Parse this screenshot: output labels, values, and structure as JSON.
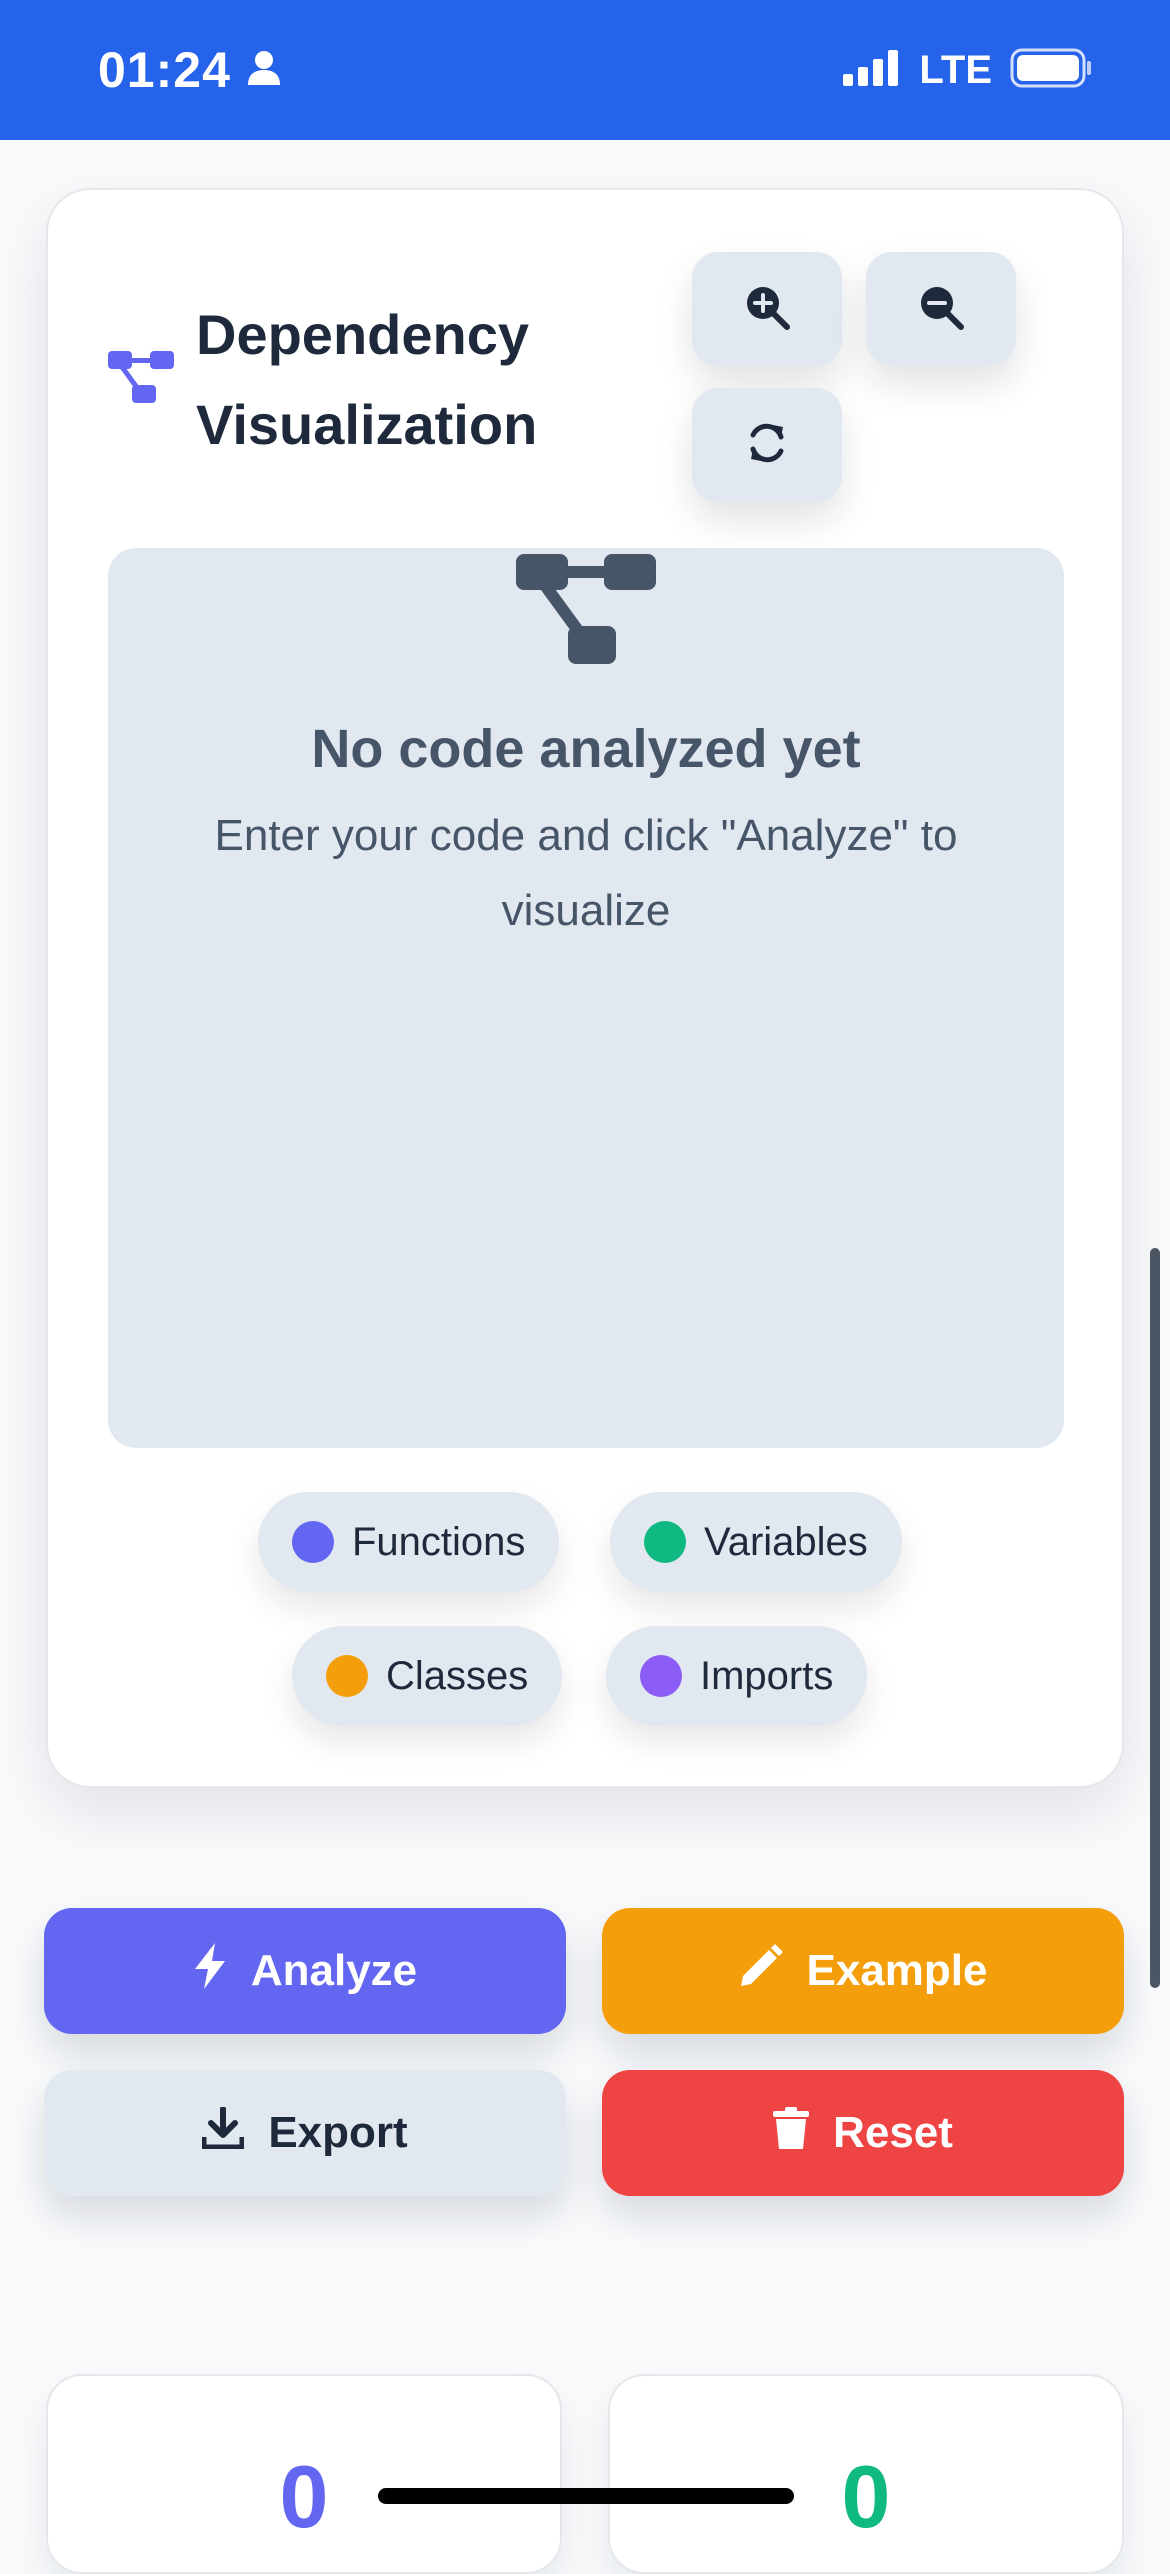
{
  "status_bar": {
    "time": "01:24",
    "network": "LTE",
    "background": "#2563eb"
  },
  "visualization": {
    "title": "Dependency Visualization",
    "title_icon": "diagram-project-icon",
    "toolbar": {
      "zoom_in_icon": "zoom-in-icon",
      "zoom_out_icon": "zoom-out-icon",
      "reset_view_icon": "refresh-icon"
    },
    "empty_state": {
      "icon": "diagram-project-icon",
      "title": "No code analyzed yet",
      "subtitle": "Enter your code and click \"Analyze\" to visualize"
    },
    "legend": [
      {
        "label": "Functions",
        "color": "#6366f1"
      },
      {
        "label": "Variables",
        "color": "#10b981"
      },
      {
        "label": "Classes",
        "color": "#f59e0b"
      },
      {
        "label": "Imports",
        "color": "#8b5cf6"
      }
    ]
  },
  "actions": {
    "analyze": {
      "label": "Analyze",
      "icon": "bolt-icon",
      "color": "#6366f1"
    },
    "example": {
      "label": "Example",
      "icon": "pencil-icon",
      "color": "#f59e0b"
    },
    "export": {
      "label": "Export",
      "icon": "download-icon",
      "color": "#e2e8f0"
    },
    "reset": {
      "label": "Reset",
      "icon": "trash-icon",
      "color": "#ef4444"
    }
  },
  "stats": [
    {
      "value": "0",
      "color": "#6366f1"
    },
    {
      "value": "0",
      "color": "#10b981"
    }
  ]
}
